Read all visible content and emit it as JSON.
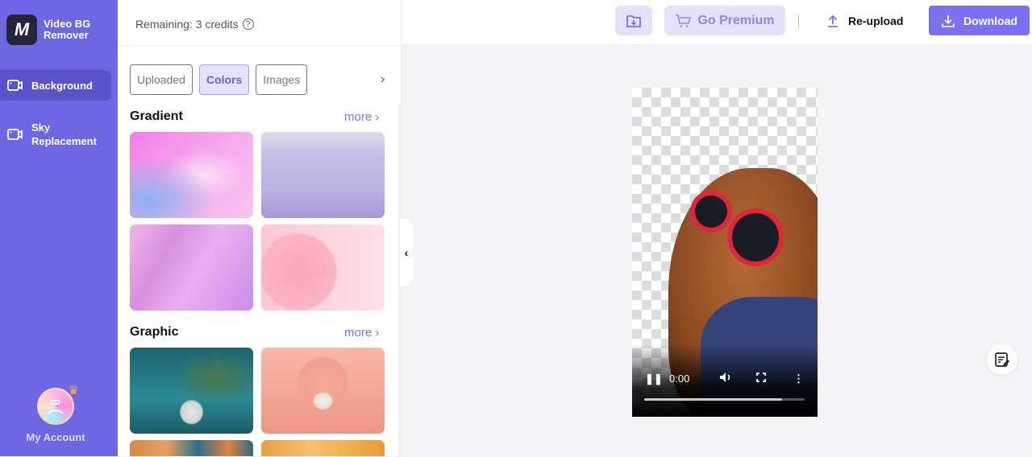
{
  "app": {
    "title_line1": "Video BG",
    "title_line2": "Remover",
    "logo_glyph": "M"
  },
  "sidebar": {
    "items": [
      {
        "label": "Background",
        "icon": "video-camera-icon",
        "active": true
      },
      {
        "label": "Sky Replacement",
        "icon": "video-camera-icon",
        "active": false
      }
    ],
    "account_label": "My Account"
  },
  "panel": {
    "credits": "Remaining: 3 credits",
    "help_glyph": "?",
    "tabs": [
      {
        "label": "Uploaded",
        "active": false
      },
      {
        "label": "Colors",
        "active": true
      },
      {
        "label": "Images",
        "active": false
      }
    ],
    "sections": [
      {
        "title": "Gradient",
        "more": "more ›"
      },
      {
        "title": "Graphic",
        "more": "more ›"
      }
    ]
  },
  "toolbar": {
    "premium_label": "Go Premium",
    "reupload_label": "Re-upload",
    "download_label": "Download"
  },
  "video": {
    "time": "0:00",
    "progress": 0.86
  },
  "colors": {
    "accent": "#7b70f0",
    "sidebar": "#6f66e4"
  }
}
